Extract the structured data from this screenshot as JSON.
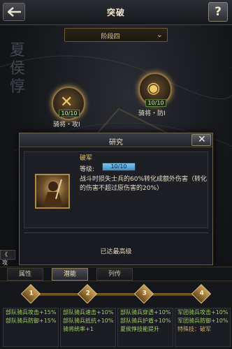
{
  "header": {
    "title": "突破",
    "help_label": "?"
  },
  "stage": {
    "label": "阶段四"
  },
  "general": {
    "name_vertical": [
      "夏",
      "侯",
      "惇"
    ]
  },
  "nodes": [
    {
      "count": "10/10",
      "name": "骑将・攻Ⅰ"
    },
    {
      "count": "10/10",
      "name": "骑将・防Ⅰ"
    }
  ],
  "dialog": {
    "title": "研究",
    "close_label": "✕",
    "skill_name": "破军",
    "level_label": "等级:",
    "level_value": "10/10",
    "level_fraction": 1.0,
    "description": "战斗时损失士兵的60%转化成额外伤害（转化的伤害不超过原伤害的20%）",
    "max_level_text": "已达最高级"
  },
  "side_tab": {
    "label": "《 攻"
  },
  "tabs": [
    {
      "label": "属性",
      "active": false
    },
    {
      "label": "潜能",
      "active": true
    },
    {
      "label": "列传",
      "active": false
    }
  ],
  "progress": {
    "markers": [
      "1",
      "2",
      "3",
      "4"
    ],
    "perks": [
      {
        "lines": [
          "部队骑兵攻击+15%",
          "部队骑兵防御+15%"
        ]
      },
      {
        "lines": [
          "部队骑兵速击+10%",
          "部队骑兵抵抗+10%",
          "骑将统率+1"
        ]
      },
      {
        "lines": [
          "部队骑兵穿透+10%",
          "部队骑兵护盾+10%",
          "夏侯惇技能提升"
        ]
      },
      {
        "lines": [
          "军团骑兵攻击+10%",
          "军团骑兵防御+10%",
          "特殊技：破军"
        ]
      }
    ]
  },
  "colors": {
    "accent_gold": "#e7cf99",
    "perk_green": "#9fcf66",
    "level_blue": "#5aa9dc"
  }
}
